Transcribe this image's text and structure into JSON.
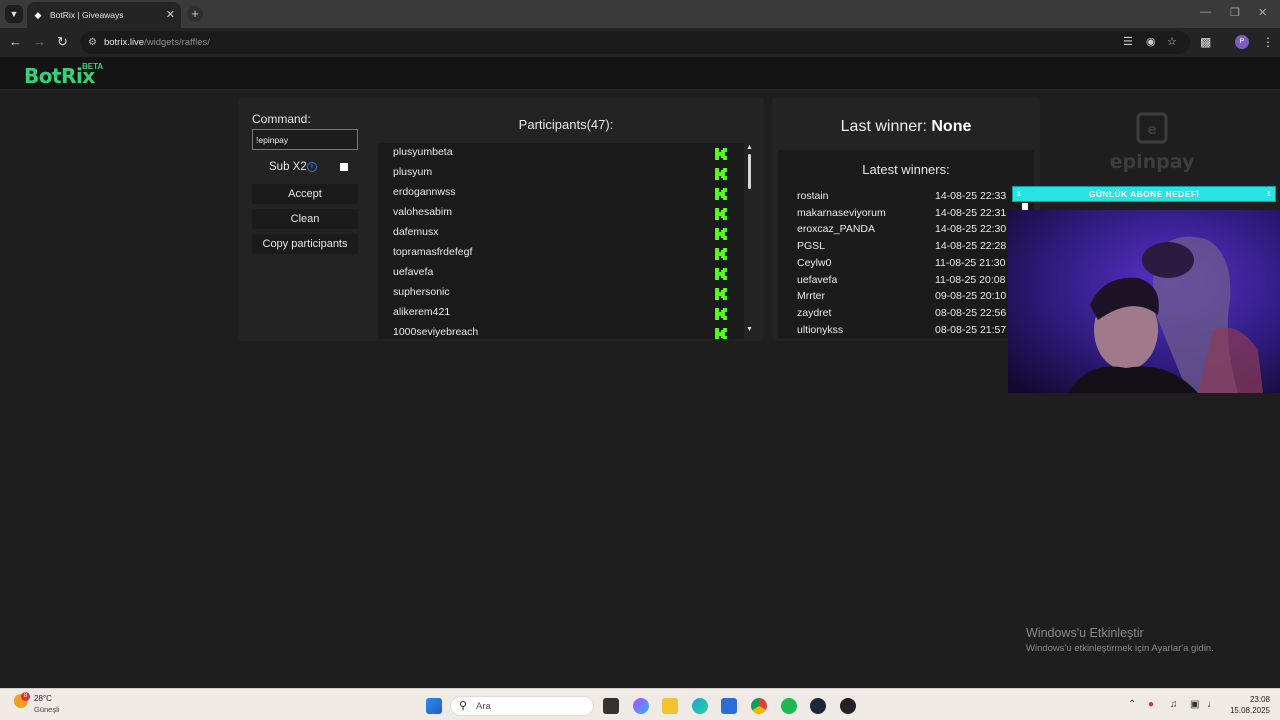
{
  "browser": {
    "tab_title": "BotRix | Giveaways",
    "url_host": "botrix.live",
    "url_path": "/widgets/raffles/"
  },
  "app": {
    "logo": "BotRix",
    "badge": "BETA"
  },
  "raffle": {
    "command_label": "Command:",
    "command_value": "!epinpay",
    "sub_label": "Sub X2",
    "sub_checked": false,
    "buttons": [
      "Accept",
      "Clean",
      "Copy participants"
    ],
    "participants_title": "Participants(47):",
    "participants": [
      "plusyumbeta",
      "plusyum",
      "erdogannwss",
      "valohesabim",
      "dafemusx",
      "topramasfrdefegf",
      "uefavefa",
      "suphersonic",
      "alikerem421",
      "1000seviyebreach"
    ]
  },
  "winners": {
    "last_winner_label": "Last winner:",
    "last_winner_value": "None",
    "latest_title": "Latest winners:",
    "list": [
      {
        "name": "rostain",
        "date": "14-08-25 22:33"
      },
      {
        "name": "makarnaseviyorum",
        "date": "14-08-25 22:31"
      },
      {
        "name": "eroxcaz_PANDA",
        "date": "14-08-25 22:30"
      },
      {
        "name": "PGSL",
        "date": "14-08-25 22:28"
      },
      {
        "name": "Ceylw0",
        "date": "11-08-25 21:30"
      },
      {
        "name": "uefavefa",
        "date": "11-08-25 20:08"
      },
      {
        "name": "Mrrter",
        "date": "09-08-25 20:10"
      },
      {
        "name": "zaydret",
        "date": "08-08-25 22:56"
      },
      {
        "name": "ultionykss",
        "date": "08-08-25 21:57"
      }
    ]
  },
  "overlay": {
    "sponsor_logo": "epinpay",
    "goal_label": "GÜNLÜK ABONE HEDEFİ",
    "goal_left": "1",
    "goal_right": "1"
  },
  "windows": {
    "activate_title": "Windows'u Etkinleştir",
    "activate_desc": "Windows'u etkinleştirmek için Ayarlar'a gidin.",
    "weather_temp": "28°C",
    "weather_desc": "Güneşli",
    "weather_badge": "8",
    "search_placeholder": "Ara",
    "time": "23:08",
    "date": "15.08.2025"
  },
  "colors": {
    "brand": "#3ad07a",
    "kick": "#53fc18",
    "goal_bar": "#27e3e3",
    "panel": "#232323"
  }
}
